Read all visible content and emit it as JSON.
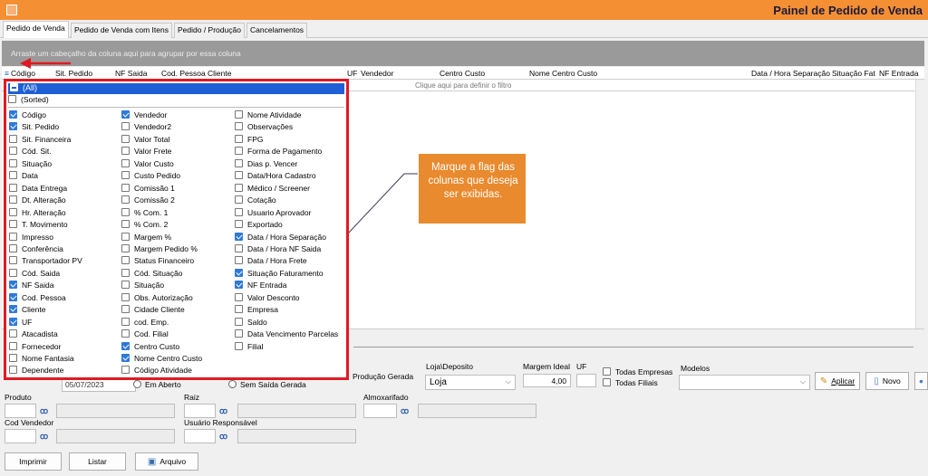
{
  "window": {
    "title": "Painel de Pedido de Venda"
  },
  "tabs": [
    "Pedido de Venda",
    "Pedido de Venda com Itens",
    "Pedido / Produção",
    "Cancelamentos"
  ],
  "grid": {
    "group_hint": "Arraste um cabeçalho da coluna aqui para agrupar por essa coluna",
    "columns": [
      "Código",
      "Sit. Pedido",
      "NF Saida",
      "Cod. Pessoa",
      "Cliente",
      "UF",
      "Vendedor",
      "Centro Custo",
      "Nome Centro Custo",
      "Data / Hora Separação",
      "Situação Fat",
      "NF Entrada"
    ],
    "filter_hint": "Clique aqui para definir o filtro"
  },
  "popup": {
    "all_label": "(All)",
    "sorted_label": "(Sorted)",
    "col1": [
      {
        "label": "Código",
        "checked": true
      },
      {
        "label": "Sit. Pedido",
        "checked": true
      },
      {
        "label": "Sit. Financeira",
        "checked": false
      },
      {
        "label": "Cód. Sit.",
        "checked": false
      },
      {
        "label": "Situação",
        "checked": false
      },
      {
        "label": "Data",
        "checked": false
      },
      {
        "label": "Data Entrega",
        "checked": false
      },
      {
        "label": "Dt. Alteração",
        "checked": false
      },
      {
        "label": "Hr. Alteração",
        "checked": false
      },
      {
        "label": "T. Movimento",
        "checked": false
      },
      {
        "label": "Impresso",
        "checked": false
      },
      {
        "label": "Conferência",
        "checked": false
      },
      {
        "label": "Transportador PV",
        "checked": false
      },
      {
        "label": "Cód. Saida",
        "checked": false
      },
      {
        "label": "NF Saida",
        "checked": true
      },
      {
        "label": "Cod. Pessoa",
        "checked": true
      },
      {
        "label": "Cliente",
        "checked": true
      },
      {
        "label": "UF",
        "checked": true
      },
      {
        "label": "Atacadista",
        "checked": false
      },
      {
        "label": "Fornecedor",
        "checked": false
      },
      {
        "label": "Nome Fantasia",
        "checked": false
      },
      {
        "label": "Dependente",
        "checked": false
      }
    ],
    "col2": [
      {
        "label": "Vendedor",
        "checked": true
      },
      {
        "label": "Vendedor2",
        "checked": false
      },
      {
        "label": "Valor Total",
        "checked": false
      },
      {
        "label": "Valor Frete",
        "checked": false
      },
      {
        "label": "Valor Custo",
        "checked": false
      },
      {
        "label": "Custo Pedido",
        "checked": false
      },
      {
        "label": "Comissão 1",
        "checked": false
      },
      {
        "label": "Comissão 2",
        "checked": false
      },
      {
        "label": "% Com. 1",
        "checked": false
      },
      {
        "label": "% Com. 2",
        "checked": false
      },
      {
        "label": "Margem %",
        "checked": false
      },
      {
        "label": "Margem Pedido %",
        "checked": false
      },
      {
        "label": "Status Financeiro",
        "checked": false
      },
      {
        "label": "Cód. Situação",
        "checked": false
      },
      {
        "label": "Situação",
        "checked": false
      },
      {
        "label": "Obs. Autorização",
        "checked": false
      },
      {
        "label": "Cidade Cliente",
        "checked": false
      },
      {
        "label": "cod. Emp.",
        "checked": false
      },
      {
        "label": "Cod. Filial",
        "checked": false
      },
      {
        "label": "Centro Custo",
        "checked": true
      },
      {
        "label": "Nome Centro Custo",
        "checked": true
      },
      {
        "label": "Código Atividade",
        "checked": false
      }
    ],
    "col3": [
      {
        "label": "Nome Atividade",
        "checked": false
      },
      {
        "label": "Observações",
        "checked": false
      },
      {
        "label": "FPG",
        "checked": false
      },
      {
        "label": "Forma de Pagamento",
        "checked": false
      },
      {
        "label": "Dias p. Vencer",
        "checked": false
      },
      {
        "label": "Data/Hora Cadastro",
        "checked": false
      },
      {
        "label": "Médico / Screener",
        "checked": false
      },
      {
        "label": "Cotação",
        "checked": false
      },
      {
        "label": "Usuario Aprovador",
        "checked": false
      },
      {
        "label": "Exportado",
        "checked": false
      },
      {
        "label": "Data / Hora Separação",
        "checked": true
      },
      {
        "label": "Data / Hora NF Saida",
        "checked": false
      },
      {
        "label": "Data / Hora Frete",
        "checked": false
      },
      {
        "label": "Situação Faturamento",
        "checked": true
      },
      {
        "label": "NF Entrada",
        "checked": true
      },
      {
        "label": "Valor Desconto",
        "checked": false
      },
      {
        "label": "Empresa",
        "checked": false
      },
      {
        "label": "Saldo",
        "checked": false
      },
      {
        "label": "Data Vencimento Parcelas",
        "checked": false
      },
      {
        "label": "Filial",
        "checked": false
      }
    ]
  },
  "callout": {
    "text": "Marque a flag das colunas que deseja ser exibidas."
  },
  "filters": {
    "date_value": "05/07/2023",
    "radio_em_aberto": "Em Aberto",
    "radio_sem_saida": "Sem Saída Gerada",
    "producao_gerada": "Produção Gerada",
    "loja_deposito_label": "Loja\\Deposito",
    "loja_value": "Loja",
    "margem_label": "Margem Ideal",
    "margem_value": "4,00",
    "uf_label": "UF",
    "todas_empresas": "Todas Empresas",
    "todas_filiais": "Todas Filiais",
    "modelos_label": "Modelos",
    "aplicar": "Aplicar",
    "novo": "Novo",
    "produto_label": "Produto",
    "raiz_label": "Raiz",
    "almoxarifado_label": "Almoxarifado",
    "cod_vendedor_label": "Cod Vendedor",
    "usuario_label": "Usuário Responsável"
  },
  "buttons": {
    "imprimir": "Imprimir",
    "listar": "Listar",
    "arquivo": "Arquivo"
  }
}
